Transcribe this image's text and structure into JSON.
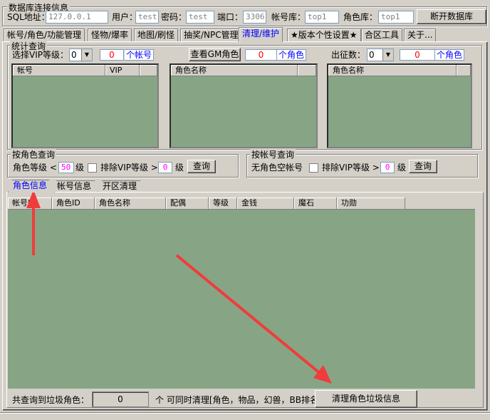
{
  "db": {
    "title": "数据库连接信息",
    "sql_label": "SQL地址：",
    "sql_value": "127.0.0.1",
    "user_label": "用户：",
    "user_value": "test",
    "pass_label": "密码：",
    "pass_value": "test",
    "port_label": "端口：",
    "port_value": "3306",
    "account_db_label": "帐号库：",
    "account_db_value": "top1",
    "role_db_label": "角色库：",
    "role_db_value": "top1",
    "disconnect_btn": "断开数据库"
  },
  "tabs": [
    {
      "label": "帐号/角色/功能管理"
    },
    {
      "label": "怪物/爆率"
    },
    {
      "label": "地图/刷怪"
    },
    {
      "label": "抽奖/NPC管理"
    },
    {
      "label": "清理/维护"
    },
    {
      "label": "★版本个性设置★"
    },
    {
      "label": "合区工具"
    },
    {
      "label": "关于..."
    }
  ],
  "stats": {
    "title": "统计查询",
    "vip_label": "选择VIP等级：",
    "vip_select": "0",
    "vip_count": "0",
    "vip_unit": "个帐号",
    "gm_btn": "查看GM角色",
    "gm_count": "0",
    "gm_unit": "个角色",
    "expedition_label": "出征数：",
    "expedition_select": "0",
    "expedition_count": "0",
    "expedition_unit": "个角色",
    "list1_cols": [
      "帐号",
      "VIP"
    ],
    "list2_cols": [
      "角色名称"
    ],
    "list3_cols": [
      "角色名称"
    ]
  },
  "by_role": {
    "title": "按角色查询",
    "level_label": "角色等级 <",
    "level_value": "50",
    "level_unit": "级",
    "exclude_label": "排除VIP等级 >",
    "exclude_value": "0",
    "exclude_unit": "级",
    "query_btn": "查询"
  },
  "by_account": {
    "title": "按帐号查询",
    "empty_label": "无角色空帐号",
    "exclude_label": "排除VIP等级 >",
    "exclude_value": "0",
    "exclude_unit": "级",
    "query_btn": "查询"
  },
  "subtabs": [
    {
      "label": "角色信息"
    },
    {
      "label": "帐号信息"
    },
    {
      "label": "开区清理"
    }
  ],
  "grid_cols": [
    "帐号ID",
    "角色ID",
    "角色名称",
    "配偶",
    "等级",
    "金钱",
    "魔石",
    "功勋"
  ],
  "footer": {
    "total_label": "共查询到垃圾角色：",
    "total_value": "0",
    "note": "个 可同时清理[角色，物品，幻兽，BB排名]",
    "clean_btn": "清理角色垃圾信息"
  },
  "colors": {
    "list_bg": "#87a584",
    "arrow": "#f03c3c"
  }
}
